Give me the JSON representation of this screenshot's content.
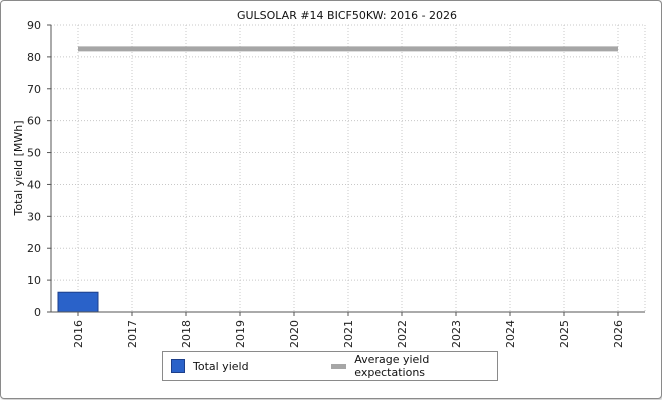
{
  "chart_data": {
    "type": "bar",
    "title": "GULSOLAR #14 BICF50KW: 2016 - 2026",
    "xlabel": "",
    "ylabel": "Total yield [MWh]",
    "categories": [
      "2016",
      "2017",
      "2018",
      "2019",
      "2020",
      "2021",
      "2022",
      "2023",
      "2024",
      "2025",
      "2026"
    ],
    "series": [
      {
        "name": "Total yield",
        "kind": "bar",
        "color": "#2a62c9",
        "values": [
          6.2,
          0,
          0,
          0,
          0,
          0,
          0,
          0,
          0,
          0,
          0
        ]
      },
      {
        "name": "Average yield expectations",
        "kind": "line",
        "color": "#a6a6a6",
        "values": [
          82.5,
          82.5,
          82.5,
          82.5,
          82.5,
          82.5,
          82.5,
          82.5,
          82.5,
          82.5,
          82.5
        ]
      }
    ],
    "ylim": [
      0,
      90
    ],
    "yticks": [
      0,
      10,
      20,
      30,
      40,
      50,
      60,
      70,
      80,
      90
    ],
    "grid": true,
    "legend_position": "bottom"
  }
}
